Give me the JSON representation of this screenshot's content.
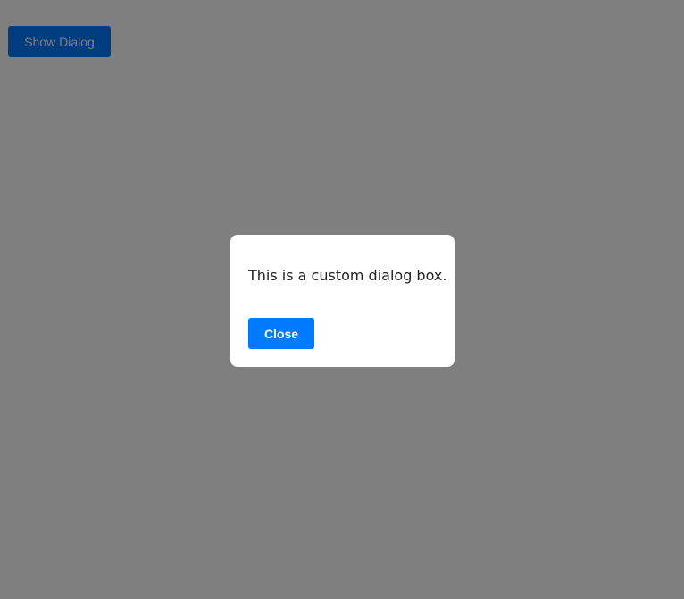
{
  "page": {
    "show_dialog_label": "Show Dialog"
  },
  "dialog": {
    "message": "This is a custom dialog box.",
    "close_label": "Close"
  },
  "colors": {
    "accent": "#007bff",
    "overlay": "rgba(0,0,0,0.5)",
    "dialog_background": "#ffffff"
  }
}
